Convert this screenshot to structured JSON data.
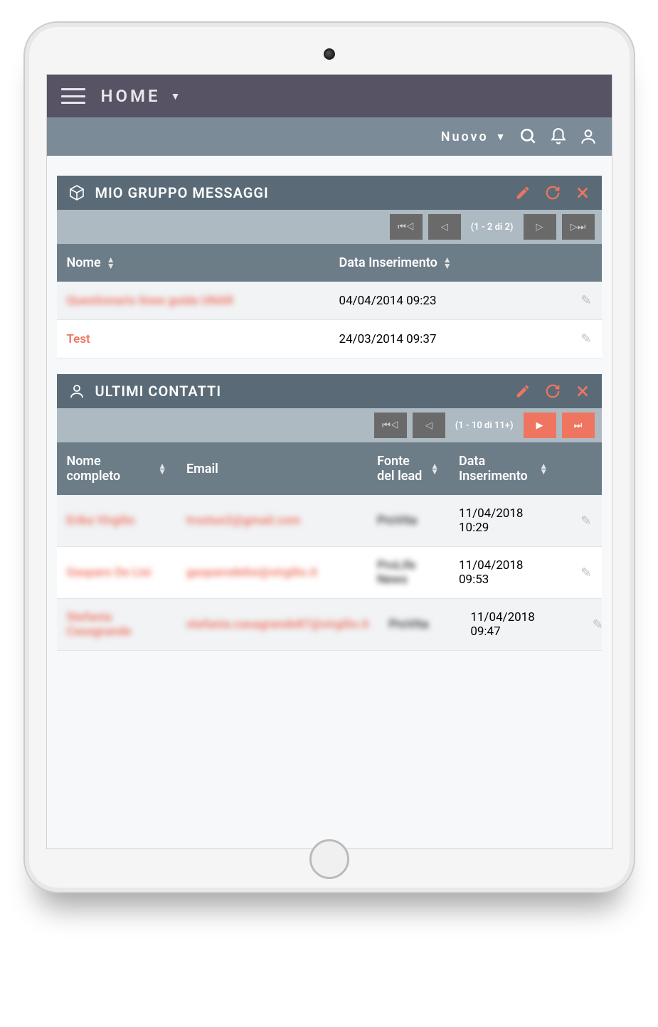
{
  "appbar": {
    "title": "HOME"
  },
  "toolbar": {
    "new_label": "Nuovo"
  },
  "panel1": {
    "title": "MIO GRUPPO MESSAGGI",
    "pager_range": "(1 - 2 di 2)",
    "columns": [
      "Nome",
      "Data Inserimento"
    ],
    "rows": [
      {
        "name": "Questionario linee guida UNAR",
        "date": "04/04/2014 09:23"
      },
      {
        "name": "Test",
        "date": "24/03/2014 09:37"
      }
    ]
  },
  "panel2": {
    "title": "ULTIMI CONTATTI",
    "pager_range": "(1 - 10 di 11+)",
    "columns": [
      "Nome completo",
      "Email",
      "Fonte del lead",
      "Data Inserimento"
    ],
    "rows": [
      {
        "name": "Erika Virgilio",
        "email": "trustuo2@gmail.com",
        "source": "ProVita",
        "date": "11/04/2018 10:29"
      },
      {
        "name": "Gasparo De Lisi",
        "email": "gasparodelisi@virgilio.it",
        "source": "ProLife News",
        "date": "11/04/2018 09:53"
      },
      {
        "name": "Stefania Casagrande",
        "email": "stefania.casagrande87@virgilio.it",
        "source": "ProVita",
        "date": "11/04/2018 09:47"
      }
    ]
  }
}
